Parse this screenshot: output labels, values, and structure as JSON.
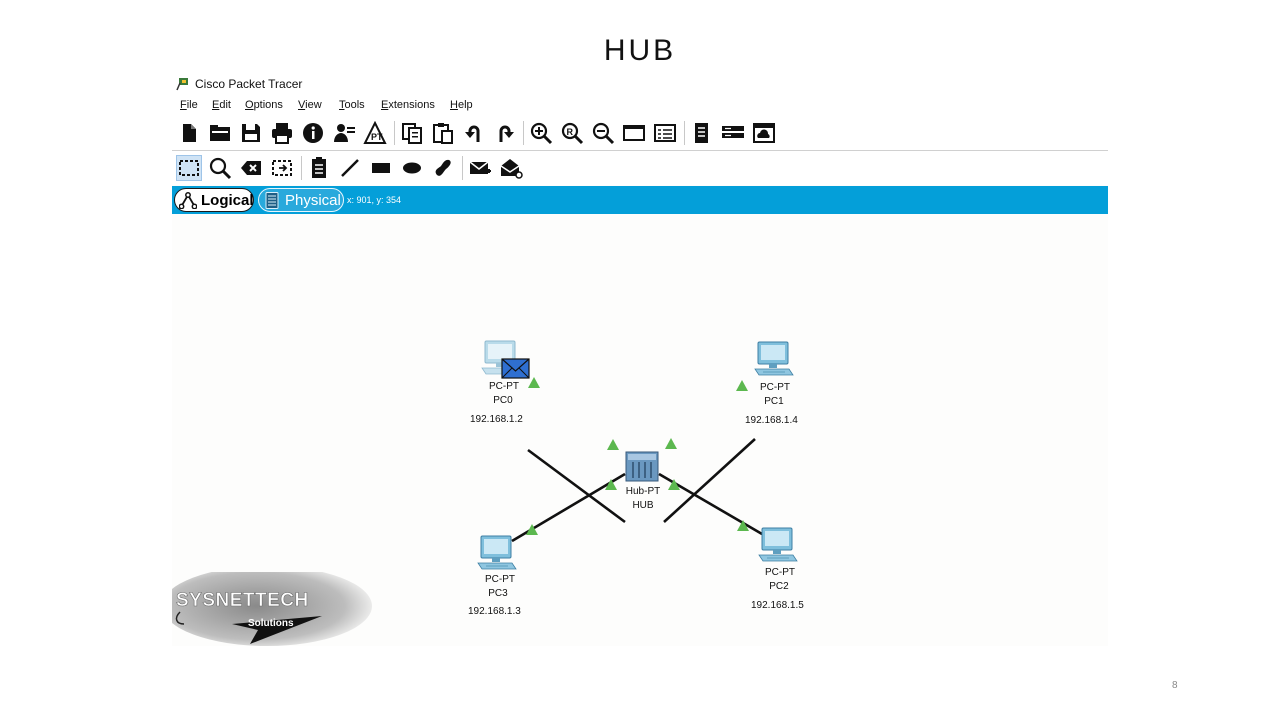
{
  "slide": {
    "title": "HUB",
    "page_number": "8"
  },
  "window": {
    "title": "Cisco Packet Tracer"
  },
  "menu": [
    {
      "label": "File",
      "mnemonic": "F"
    },
    {
      "label": "Edit",
      "mnemonic": "E"
    },
    {
      "label": "Options",
      "mnemonic": "O"
    },
    {
      "label": "View",
      "mnemonic": "V"
    },
    {
      "label": "Tools",
      "mnemonic": "T"
    },
    {
      "label": "Extensions",
      "mnemonic": "E"
    },
    {
      "label": "Help",
      "mnemonic": "H"
    }
  ],
  "toolbar_main": [
    "new-file-icon",
    "open-folder-icon",
    "save-icon",
    "print-icon",
    "info-icon",
    "activity-wizard-icon",
    "pt-builder-icon",
    "copy-icon",
    "paste-icon",
    "undo-icon",
    "redo-icon",
    "zoom-in-icon",
    "zoom-reset-icon",
    "zoom-out-icon",
    "drawing-palette-icon",
    "custom-device-dialog-icon",
    "viewport-icon",
    "device-list-icon",
    "cloud-icon"
  ],
  "toolbar_tools": [
    "select-icon",
    "inspect-icon",
    "delete-icon",
    "resize-shape-icon",
    "place-note-icon",
    "draw-line-icon",
    "draw-rectangle-icon",
    "draw-ellipse-icon",
    "freeform-icon",
    "add-simple-pdu-icon",
    "add-complex-pdu-icon"
  ],
  "tabs": {
    "logical": "Logical",
    "physical": "Physical",
    "coords": "x: 901, y: 354"
  },
  "topology": {
    "hub": {
      "type": "Hub-PT",
      "name": "HUB"
    },
    "pcs": [
      {
        "type": "PC-PT",
        "name": "PC0",
        "ip": "192.168.1.2",
        "has_pdu": true
      },
      {
        "type": "PC-PT",
        "name": "PC1",
        "ip": "192.168.1.4",
        "has_pdu": false
      },
      {
        "type": "PC-PT",
        "name": "PC3",
        "ip": "192.168.1.3",
        "has_pdu": false
      },
      {
        "type": "PC-PT",
        "name": "PC2",
        "ip": "192.168.1.5",
        "has_pdu": false
      }
    ]
  },
  "watermark": {
    "brand": "SYSNETTECH",
    "sub": "Solutions"
  },
  "colors": {
    "tab_bar": "#049fd9",
    "link": "#111111",
    "link_light": "#5cb84f",
    "pc": "#5fa8cc",
    "hub": "#5c8ab3",
    "pdu": "#2f6fd0"
  }
}
